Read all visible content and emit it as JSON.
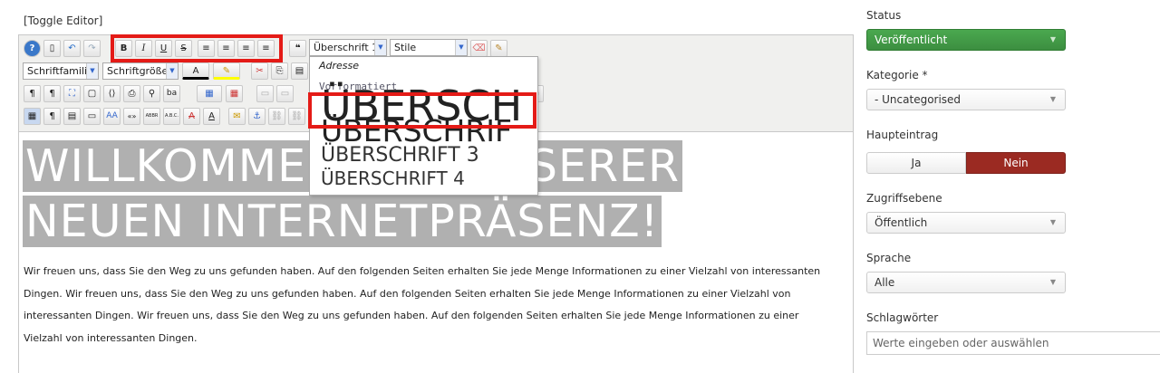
{
  "editor": {
    "toggle_label": "[Toggle Editor]",
    "toolbar": {
      "row1": {
        "btn_bold": "B",
        "btn_italic": "I",
        "btn_underline": "U",
        "btn_strike": "S",
        "btn_quote": "❝",
        "format_select": "Überschrift 1",
        "style_select": "Stile"
      },
      "row2": {
        "font_family": "Schriftfamilie",
        "font_size": "Schriftgröße",
        "text_color": "A"
      },
      "row4": {
        "btn_case": "AA",
        "btn_quot": "«»",
        "btn_abbr": "ABBR",
        "btn_acronym": "A.B.C.",
        "btn_del": "A",
        "btn_ins": "A"
      }
    },
    "format_dropdown": {
      "items": [
        "Adresse",
        "Vorformatiert",
        "ÜBERSCH",
        "ÜBERSCHRIF",
        "ÜBERSCHRIFT 3",
        "ÜBERSCHRIFT 4"
      ]
    },
    "content": {
      "heading_line1": "WILLKOMMEN AUF UNSERER",
      "heading_line2": "NEUEN INTERNETPRÄSENZ!",
      "paragraph": "Wir freuen uns, dass Sie den Weg zu uns gefunden haben. Auf den folgenden Seiten erhalten Sie jede Menge Informationen zu einer Vielzahl von interessanten Dingen. Wir freuen uns, dass Sie den Weg zu uns gefunden haben. Auf den folgenden Seiten erhalten Sie jede Menge Informationen zu einer Vielzahl von interessanten Dingen. Wir freuen uns, dass Sie den Weg zu uns gefunden haben. Auf den folgenden Seiten erhalten Sie jede Menge Informationen zu einer Vielzahl von interessanten Dingen."
    }
  },
  "sidebar": {
    "status": {
      "label": "Status",
      "value": "Veröffentlicht"
    },
    "category": {
      "label": "Kategorie *",
      "value": "- Uncategorised"
    },
    "featured": {
      "label": "Haupteintrag",
      "yes": "Ja",
      "no": "Nein"
    },
    "access": {
      "label": "Zugriffsebene",
      "value": "Öffentlich"
    },
    "language": {
      "label": "Sprache",
      "value": "Alle"
    },
    "tags": {
      "label": "Schlagwörter",
      "placeholder": "Werte eingeben oder auswählen"
    }
  },
  "colors": {
    "status_green": "#3c8e40",
    "nein_red": "#9b2a22",
    "highlight_red": "#e41b17",
    "heading_bg": "#b0b0b0"
  }
}
